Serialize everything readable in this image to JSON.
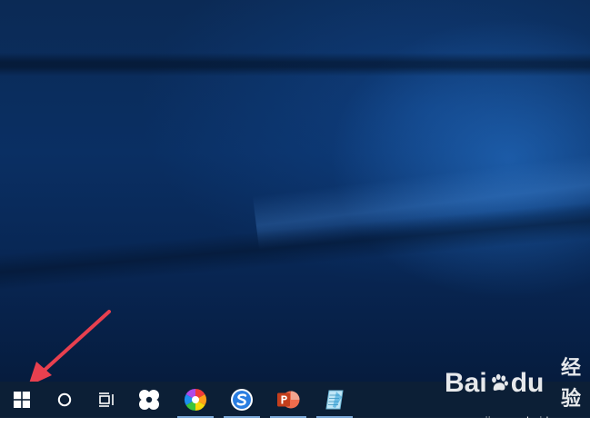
{
  "screen": {
    "accent_color": "#0a2f63",
    "taskbar_color": "#0c1f36"
  },
  "annotation": {
    "arrow_color": "#e8404f"
  },
  "taskbar": {
    "start": {
      "icon": "windows-logo-icon"
    },
    "search": {
      "icon": "cortana-circle-icon"
    },
    "task_view": {
      "icon": "task-view-icon"
    },
    "pinned_apps": [
      {
        "icon": "app-icon-white-petal",
        "running": false
      },
      {
        "icon": "color-wheel-icon",
        "running": true
      },
      {
        "icon": "sogou-s-icon",
        "running": true
      },
      {
        "icon": "powerpoint-icon",
        "running": true
      },
      {
        "icon": "notepad-icon",
        "running": true
      }
    ]
  },
  "watermark": {
    "brand_left": "Bai",
    "brand_right": "du",
    "brand_cn": "经验",
    "url": "jingyan.baidu.com"
  }
}
